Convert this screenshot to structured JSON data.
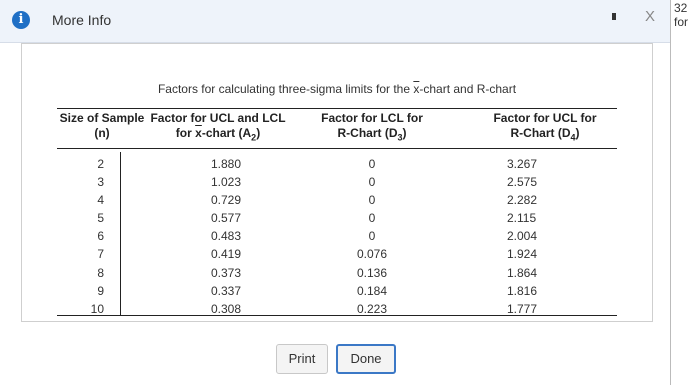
{
  "header": {
    "title": "More Info",
    "info_glyph": "i",
    "close_glyph": "X"
  },
  "right_edge": {
    "line1": "32",
    "line2": "for"
  },
  "table": {
    "title_prefix": "Factors for calculating three-sigma limits for the ",
    "title_xbar": "x",
    "title_suffix": "-chart and R-chart",
    "headers": {
      "n_line1": "Size of Sample",
      "n_line2": "(n)",
      "a2_line1": "Factor for UCL and LCL",
      "a2_pre": "for ",
      "a2_xbar": "x",
      "a2_mid": "-chart (A",
      "a2_sub": "2",
      "a2_end": ")",
      "d3_line1": "Factor for LCL for",
      "d3_mid": "R-Chart (D",
      "d3_sub": "3",
      "d3_end": ")",
      "d4_line1": "Factor for UCL for",
      "d4_mid": "R-Chart (D",
      "d4_sub": "4",
      "d4_end": ")"
    },
    "rows": [
      {
        "n": "2",
        "a2": "1.880",
        "d3": "0",
        "d4": "3.267"
      },
      {
        "n": "3",
        "a2": "1.023",
        "d3": "0",
        "d4": "2.575"
      },
      {
        "n": "4",
        "a2": "0.729",
        "d3": "0",
        "d4": "2.282"
      },
      {
        "n": "5",
        "a2": "0.577",
        "d3": "0",
        "d4": "2.115"
      },
      {
        "n": "6",
        "a2": "0.483",
        "d3": "0",
        "d4": "2.004"
      },
      {
        "n": "7",
        "a2": "0.419",
        "d3": "0.076",
        "d4": "1.924"
      },
      {
        "n": "8",
        "a2": "0.373",
        "d3": "0.136",
        "d4": "1.864"
      },
      {
        "n": "9",
        "a2": "0.337",
        "d3": "0.184",
        "d4": "1.816"
      },
      {
        "n": "10",
        "a2": "0.308",
        "d3": "0.223",
        "d4": "1.777"
      }
    ]
  },
  "buttons": {
    "print": "Print",
    "done": "Done"
  },
  "colors": {
    "info_icon": "#1f6fc5",
    "header_bg": "#eef3fa",
    "done_border": "#3b78c6"
  }
}
